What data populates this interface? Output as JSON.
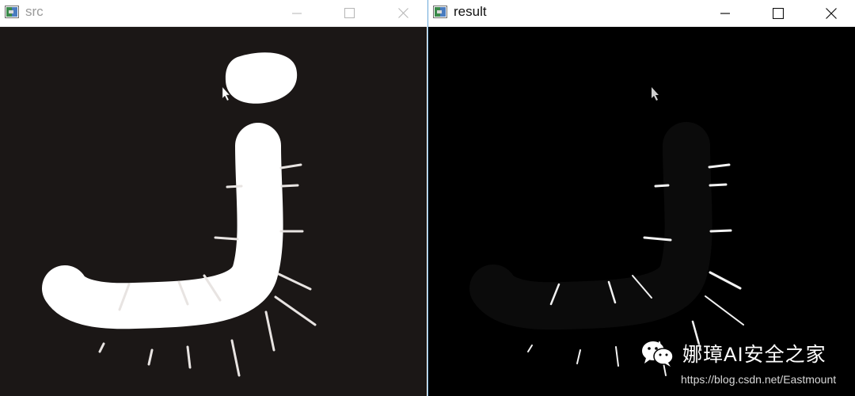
{
  "windows": [
    {
      "title": "src",
      "active": false
    },
    {
      "title": "result",
      "active": true
    }
  ],
  "controls": {
    "minimize": "minimize-icon",
    "maximize": "maximize-icon",
    "close": "close-icon"
  },
  "watermark": {
    "brand": "娜璋AI安全之家",
    "url": "https://blog.csdn.net/Eastmount"
  },
  "colors": {
    "src_background": "#1b1716",
    "result_background": "#000000",
    "foreground": "#ffffff",
    "window_divider": "#6aa8d8"
  }
}
